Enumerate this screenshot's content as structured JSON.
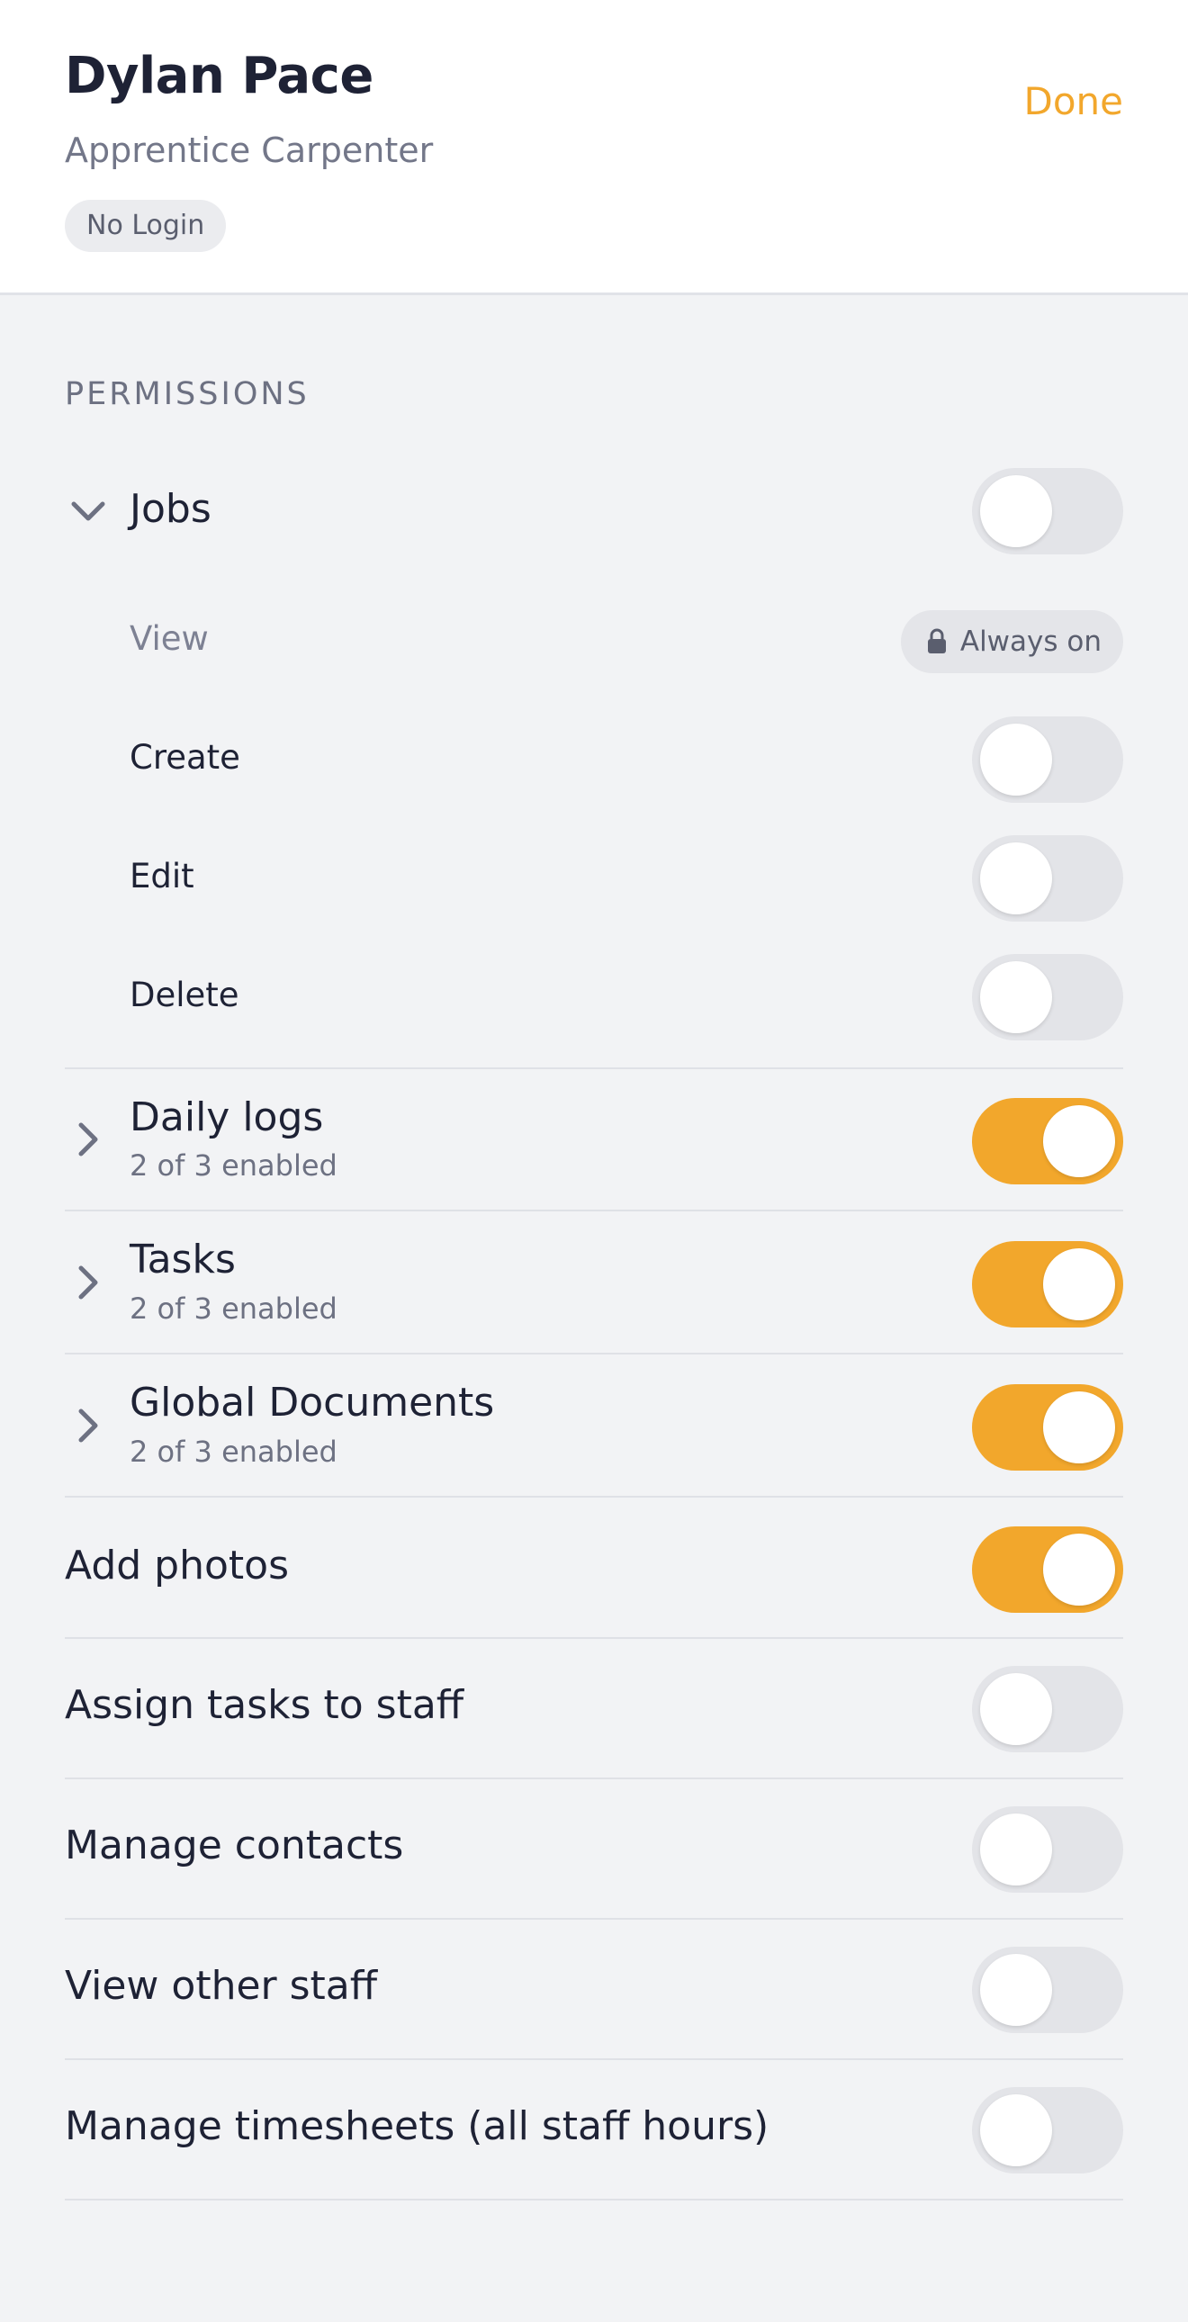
{
  "header": {
    "name": "Dylan Pace",
    "role": "Apprentice Carpenter",
    "badge": "No Login",
    "done_label": "Done"
  },
  "permissions": {
    "section_title": "PERMISSIONS",
    "jobs": {
      "label": "Jobs",
      "enabled": false,
      "expanded": true,
      "items": [
        {
          "label": "View",
          "status": "Always on"
        },
        {
          "label": "Create",
          "enabled": false
        },
        {
          "label": "Edit",
          "enabled": false
        },
        {
          "label": "Delete",
          "enabled": false
        }
      ]
    },
    "groups": [
      {
        "label": "Daily logs",
        "summary": "2 of 3 enabled",
        "enabled": true
      },
      {
        "label": "Tasks",
        "summary": "2 of 3 enabled",
        "enabled": true
      },
      {
        "label": "Global Documents",
        "summary": "2 of 3 enabled",
        "enabled": true
      }
    ],
    "single": [
      {
        "label": "Add photos",
        "enabled": true
      },
      {
        "label": "Assign tasks to staff",
        "enabled": false
      },
      {
        "label": "Manage contacts",
        "enabled": false
      },
      {
        "label": "View other staff",
        "enabled": false
      },
      {
        "label": "Manage timesheets (all staff hours)",
        "enabled": false
      }
    ]
  },
  "colors": {
    "accent": "#f2a72c",
    "toggle_off": "#e3e4e8",
    "text": "#1e2235",
    "muted": "#6d7182",
    "background": "#f2f3f5"
  }
}
